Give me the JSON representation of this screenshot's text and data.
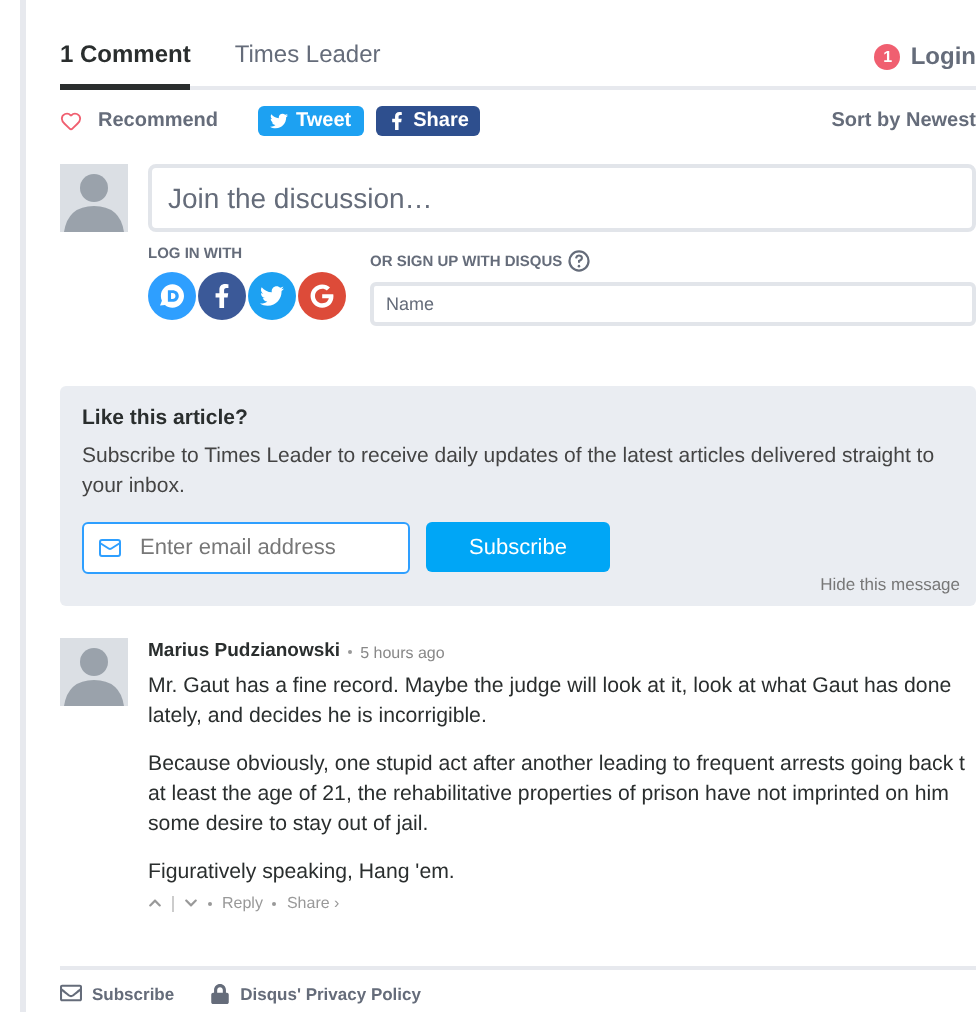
{
  "tabs": [
    {
      "label": "1 Comment",
      "selected": true
    },
    {
      "label": "Times Leader",
      "selected": false
    }
  ],
  "login": {
    "badge": "1",
    "label": "Login"
  },
  "recommend": {
    "label": "Recommend"
  },
  "share_buttons": [
    {
      "kind": "twitter",
      "label": "Tweet"
    },
    {
      "kind": "facebook",
      "label": "Share"
    }
  ],
  "sort": "Sort by Newest",
  "composer": {
    "placeholder": "Join the discussion…",
    "login_label": "LOG IN WITH",
    "providers": [
      {
        "kind": "disqus"
      },
      {
        "kind": "facebook"
      },
      {
        "kind": "twitter"
      },
      {
        "kind": "google"
      }
    ],
    "signup_label": "OR SIGN UP WITH DISQUS",
    "name_placeholder": "Name"
  },
  "promo": {
    "title": "Like this article?",
    "text": "Subscribe to Times Leader to receive daily updates of the latest articles delivered straight to your inbox.",
    "email_placeholder": "Enter email address",
    "button": "Subscribe",
    "hide": "Hide this message"
  },
  "comments": [
    {
      "author": "Marius Pudzianowski",
      "time": "5 hours ago",
      "paragraphs": [
        "Mr. Gaut has a fine record. Maybe the judge will look at it, look at what Gaut has done lately, and decides he is incorrigible.",
        "Because obviously, one stupid act after another leading to frequent arrests going back t at least the age of 21, the rehabilitative properties of prison have not imprinted on him some desire to stay out of jail.",
        "Figuratively speaking, Hang 'em."
      ],
      "actions": [
        "Reply",
        "Share ›"
      ]
    }
  ],
  "footer": [
    {
      "kind": "subscribe",
      "label": "Subscribe"
    },
    {
      "kind": "privacy",
      "label": "Disqus' Privacy Policy"
    }
  ]
}
